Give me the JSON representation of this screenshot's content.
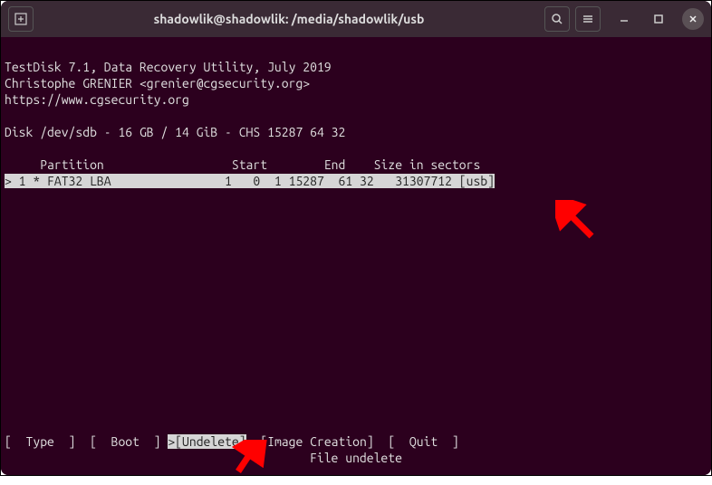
{
  "titlebar": {
    "title": "shadowlik@shadowlik: /media/shadowlik/usb"
  },
  "program": {
    "line1": "TestDisk 7.1, Data Recovery Utility, July 2019",
    "line2": "Christophe GRENIER <grenier@cgsecurity.org>",
    "line3": "https://www.cgsecurity.org"
  },
  "disk": {
    "line": "Disk /dev/sdb - 16 GB / 14 GiB - CHS 15287 64 32"
  },
  "table": {
    "header": "     Partition                  Start        End    Size in sectors",
    "row": "> 1 * FAT32 LBA                1   0  1 15287  61 32   31307712 [usb]"
  },
  "menu": {
    "prefix": "[  Type  ]  [  Boot  ] ",
    "selected": ">[Undelete]",
    "suffix": "  [Image Creation]  [  Quit  ]"
  },
  "hint": "File undelete"
}
